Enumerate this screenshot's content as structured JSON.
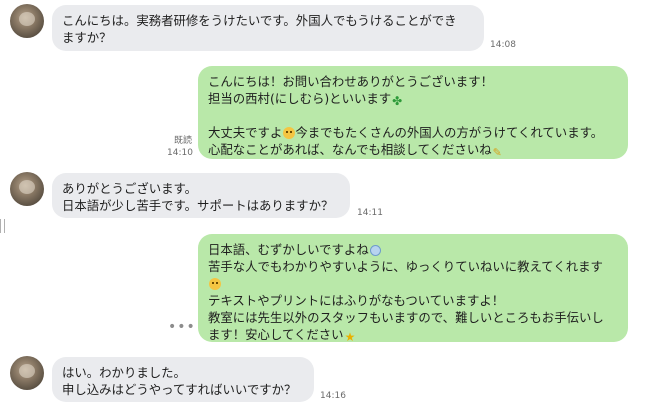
{
  "messages": [
    {
      "lines": [
        "こんにちは。実務者研修をうけたいです。外国人でもうけることができ",
        "ますか？"
      ],
      "time": "14:08"
    },
    {
      "line1": "こんにちは！お問い合わせありがとうございます！",
      "line2": "担当の西村(にしむら)といいます",
      "line3": "大丈夫ですよ",
      "line3b": "今までもたくさんの外国人の方がうけてくれています。",
      "line4": "心配なことがあれば、なんでも相談してくださいね",
      "read": "既読",
      "time": "14:10",
      "icons": [
        "clover-icon",
        "smile-face-icon",
        "sparkle-icon"
      ]
    },
    {
      "lines": [
        "ありがとうございます。",
        "日本語が少し苦手です。サポートはありますか？"
      ],
      "time": "14:11"
    },
    {
      "line1": "日本語、むずかしいですよね",
      "line2": "苦手な人でもわかりやすいように、ゆっくりていねいに教えてくれます",
      "line4": "テキストやプリントにはふりがなもついていますよ！",
      "line5": "教室には先生以外のスタッフもいますので、難しいところもお手伝いし",
      "line6": "ます！安心してください",
      "more": "•••",
      "icons": [
        "sweat-drop-icon",
        "smile-face-icon",
        "star-icon"
      ]
    },
    {
      "lines": [
        "はい。わかりました。",
        "申し込みはどうやってすればいいですか？"
      ],
      "time": "14:16"
    }
  ],
  "colors": {
    "incoming_bubble": "#eaebee",
    "outgoing_bubble": "#b9e8a9",
    "background": "#ffffff"
  }
}
